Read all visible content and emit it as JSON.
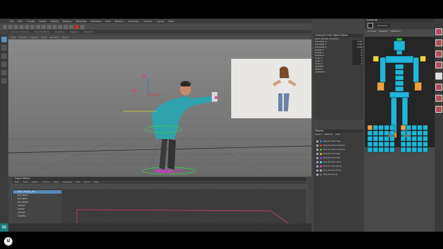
{
  "menubar": {
    "items": [
      "File",
      "Edit",
      "Create",
      "Select",
      "Modify",
      "Display",
      "Windows",
      "Skeleton",
      "Skin",
      "Deform",
      "Constrain",
      "Control",
      "Cache",
      "Help"
    ]
  },
  "viewport_menu": [
    "View",
    "Shading",
    "Lighting",
    "Show",
    "Renderer",
    "Panels"
  ],
  "status_tabs": [
    "Curves / Surfaces",
    "Poly Modeling",
    "Sculpting",
    "Rigging",
    "Animation"
  ],
  "outliner": {
    "header": [
      "Channels",
      "Edit",
      "Object",
      "Show"
    ],
    "node": "Hello_MoCap_Template",
    "attrs": [
      {
        "name": "Translate X",
        "value": "0.00"
      },
      {
        "name": "Translate Y",
        "value": "0.00"
      },
      {
        "name": "Translate Z",
        "value": "0.00"
      },
      {
        "name": "Rotate X",
        "value": "0"
      },
      {
        "name": "Rotate Y",
        "value": "0"
      },
      {
        "name": "Rotate Z",
        "value": "0"
      },
      {
        "name": "Scale X",
        "value": "1"
      },
      {
        "name": "Scale Y",
        "value": "1"
      },
      {
        "name": "Scale Z",
        "value": "1"
      }
    ],
    "shapes_label": "SHAPES",
    "inputs_label": "INPUTS",
    "outputs_label": "OUTPUTS"
  },
  "display_panel": {
    "header": "Display",
    "tabs": [
      "Layers",
      "Options",
      "Help"
    ],
    "layers": [
      "Ref_01 Char Geo",
      "Ref_02 Char Skeleton",
      "Ref_03 Char Controls",
      "Ref_04 Char Rig",
      "Ref_05 Char Ctrl",
      "Ref_06 Char Face",
      "Ref_07 Char Body",
      "Ref_08 Char Prop",
      "Ref_09 Mocap"
    ]
  },
  "hik": {
    "title": "HumanIK",
    "source_label": "Character",
    "tabs": [
      "Controls",
      "Skeleton",
      "Definition"
    ]
  },
  "graph_editor": {
    "title": "Graph Editor",
    "menu": [
      "Edit",
      "View",
      "Select",
      "Curves",
      "Keys",
      "Tangents",
      "List",
      "Show",
      "Help"
    ],
    "items": [
      "Hello_MoCap_Ctrl",
      "translateX",
      "translateY",
      "translateZ",
      "rotateX",
      "rotateY",
      "rotateZ",
      "visibility"
    ],
    "selected_index": 0
  },
  "colors": {
    "hik_blue": "#1fb6d9",
    "hik_orange": "#f2a03c",
    "hik_yellow": "#f2d43c",
    "hik_green": "#3bb33b",
    "curve_pink": "#d23c7a",
    "curve_blue": "#3b7fd2"
  },
  "logo_letter": "M",
  "udemy_letter": "U"
}
